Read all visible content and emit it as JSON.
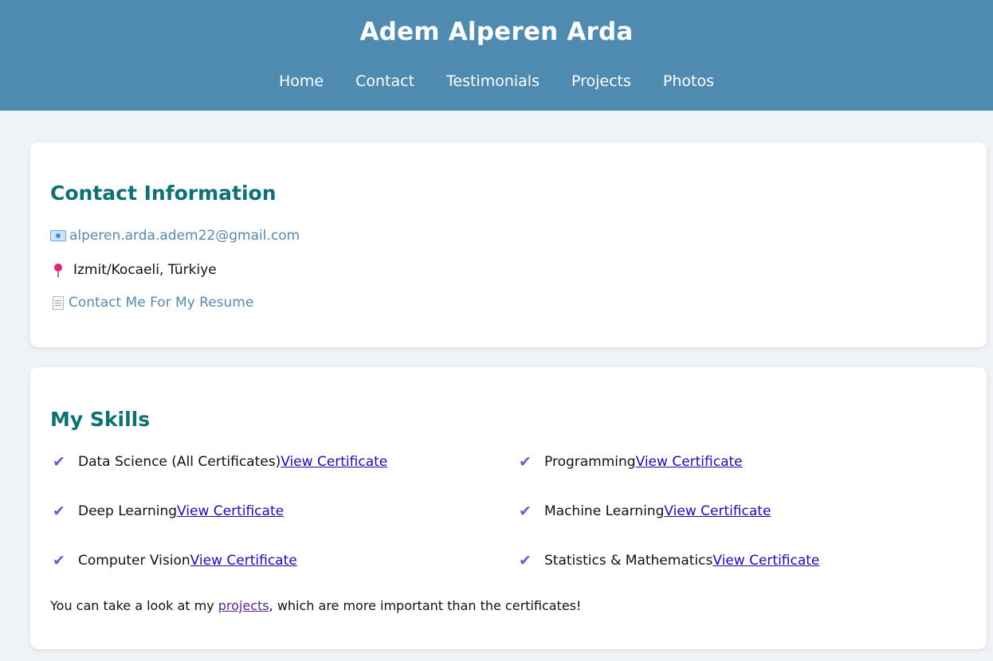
{
  "header": {
    "title": "Adem Alperen Arda",
    "nav": [
      "Home",
      "Contact",
      "Testimonials",
      "Projects",
      "Photos"
    ]
  },
  "contact": {
    "title": "Contact Information",
    "email": "alperen.arda.adem22@gmail.com",
    "location": "Izmit/Kocaeli, Türkiye",
    "resume": "Contact Me For My Resume"
  },
  "skills": {
    "title": "My Skills",
    "link_label": "View Certificate",
    "items": [
      "Data Science (All Certificates)",
      "Programming",
      "Deep Learning",
      "Machine Learning",
      "Computer Vision",
      "Statistics & Mathematics"
    ],
    "note_before": "You can take a look at my ",
    "note_link": "projects",
    "note_after": ", which are more important than the certificates!"
  },
  "colors": {
    "header_bg": "#4f8bb0",
    "heading": "#0f6f73",
    "check": "#7b57c9",
    "cert_link": "#1a0dab"
  },
  "icons": [
    "envelope-icon",
    "pushpin-icon",
    "document-icon",
    "checkmark-icon"
  ]
}
